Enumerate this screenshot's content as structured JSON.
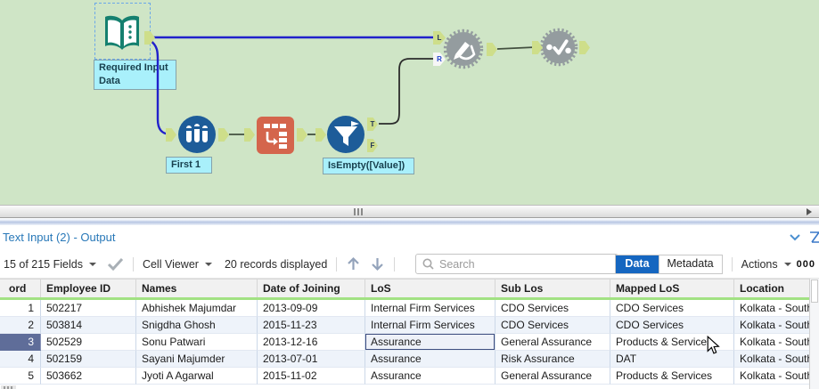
{
  "canvas": {
    "tool_labels": {
      "text_input": "Required Input Data",
      "sample": "First 1",
      "filter": "IsEmpty([Value])"
    },
    "anchor_letters": {
      "L": "L",
      "R": "R",
      "T": "T",
      "F": "F"
    }
  },
  "results_panel": {
    "title": "Text Input (2) - Output",
    "toolbar": {
      "fields_summary": "15 of 215 Fields",
      "cell_viewer_label": "Cell Viewer",
      "records_displayed": "20 records displayed",
      "search_placeholder": "Search",
      "data_button": "Data",
      "metadata_button": "Metadata",
      "actions_label": "Actions",
      "overflow_text": "000"
    },
    "table": {
      "headers": [
        "ord",
        "Employee ID",
        "Names",
        "Date of Joining",
        "LoS",
        "Sub Los",
        "Mapped LoS",
        "Location"
      ],
      "rows": [
        {
          "record": "1",
          "cells": [
            "502217",
            "Abhishek Majumdar",
            "2013-09-09",
            "Internal Firm Services",
            "CDO Services",
            "CDO Services",
            "Kolkata - South Ci"
          ]
        },
        {
          "record": "2",
          "cells": [
            "503814",
            "Snigdha Ghosh",
            "2015-11-23",
            "Internal Firm Services",
            "CDO Services",
            "CDO Services",
            "Kolkata - South Ci"
          ]
        },
        {
          "record": "3",
          "selected": true,
          "selected_cell": 3,
          "cells": [
            "502529",
            "Sonu Patwari",
            "2013-12-16",
            "Assurance",
            "General Assurance",
            "Products & Services",
            "Kolkata - South Ci"
          ]
        },
        {
          "record": "4",
          "cells": [
            "502159",
            "Sayani Majumder",
            "2013-07-01",
            "Assurance",
            "Risk Assurance",
            "DAT",
            "Kolkata - South Ci"
          ]
        },
        {
          "record": "5",
          "cells": [
            "503662",
            "Jyoti A Agarwal",
            "2015-11-02",
            "Assurance",
            "General Assurance",
            "Products & Services",
            "Kolkata - South Ci"
          ]
        }
      ]
    }
  },
  "colors": {
    "canvas_bg": "#cfe5c6",
    "selected_wire_blue": "#2121cb",
    "wire_dark": "#43503f",
    "tool_label_cyan": "#a9f0fb",
    "anchor_green": "#cede8a",
    "data_button_blue": "#1566c0",
    "header_green_bar": "#a2e283",
    "selected_record_gutter": "#5f6d99",
    "results_title_blue": "#2878b8"
  }
}
